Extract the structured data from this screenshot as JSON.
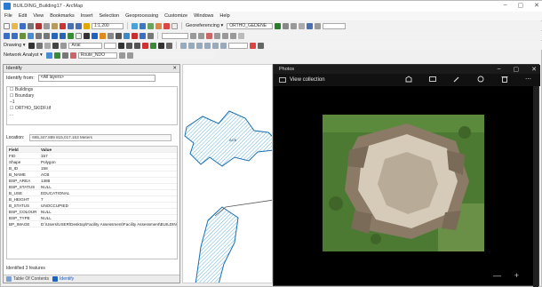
{
  "window": {
    "title": "BUILDING_Building17 - ArcMap",
    "controls": [
      "–",
      "▢",
      "✕"
    ]
  },
  "menu": [
    "File",
    "Edit",
    "View",
    "Bookmarks",
    "Insert",
    "Selection",
    "Geoprocessing",
    "Customize",
    "Windows",
    "Help"
  ],
  "toolbar": {
    "scale": "1:1,200",
    "georef_label": "Georeferencing ▾",
    "georef_layer": "ORTHO_GEDENE",
    "drawing_label": "Drawing ▾",
    "font_value": "Arial",
    "network_label": "Network Analyst ▾",
    "network_value": "Route_NDO"
  },
  "identify": {
    "title": "Identify",
    "close": "✕",
    "from_label": "Identify from:",
    "from_value": "<All layers>",
    "tree": [
      "☐ Buildings",
      "",
      "☐ Boundary",
      "  –1",
      "☐ ORTHO_SKIDF.tif",
      "  ..."
    ],
    "location_label": "Location:",
    "location_value": "685,347.889 815,017.153 Meters",
    "columns": [
      "Field",
      "Value"
    ],
    "rows": [
      {
        "f": "FID",
        "v": "157"
      },
      {
        "f": "Shape",
        "v": "Polygon"
      },
      {
        "f": "B_ID",
        "v": "158"
      },
      {
        "f": "B_NAME",
        "v": "ACB"
      },
      {
        "f": "BSP_AREA",
        "v": "1388"
      },
      {
        "f": "BSP_STATUS",
        "v": "NULL"
      },
      {
        "f": "B_USE",
        "v": "EDUCATIONAL"
      },
      {
        "f": "B_HEIGHT",
        "v": "7"
      },
      {
        "f": "B_STATUS",
        "v": "UNOCCUPIED"
      },
      {
        "f": "BSP_COLOUR",
        "v": "NULL"
      },
      {
        "f": "BSP_TYPE",
        "v": "NULL"
      },
      {
        "f": "BP_IMAGE",
        "v": "D:\\Users\\USER\\Desktop\\Facility Assessment\\Facility Assessment\\BUILDING\\..."
      }
    ],
    "footer": "Identified 3 features",
    "tabs": [
      "Table Of Contents",
      "Identify"
    ]
  },
  "map": {
    "label": "ACB"
  },
  "photos": {
    "app_title": "Photos",
    "controls": [
      "–",
      "▢",
      "✕"
    ],
    "view_collection": "View collection",
    "zoom_minus": "—",
    "zoom_plus": "+"
  }
}
